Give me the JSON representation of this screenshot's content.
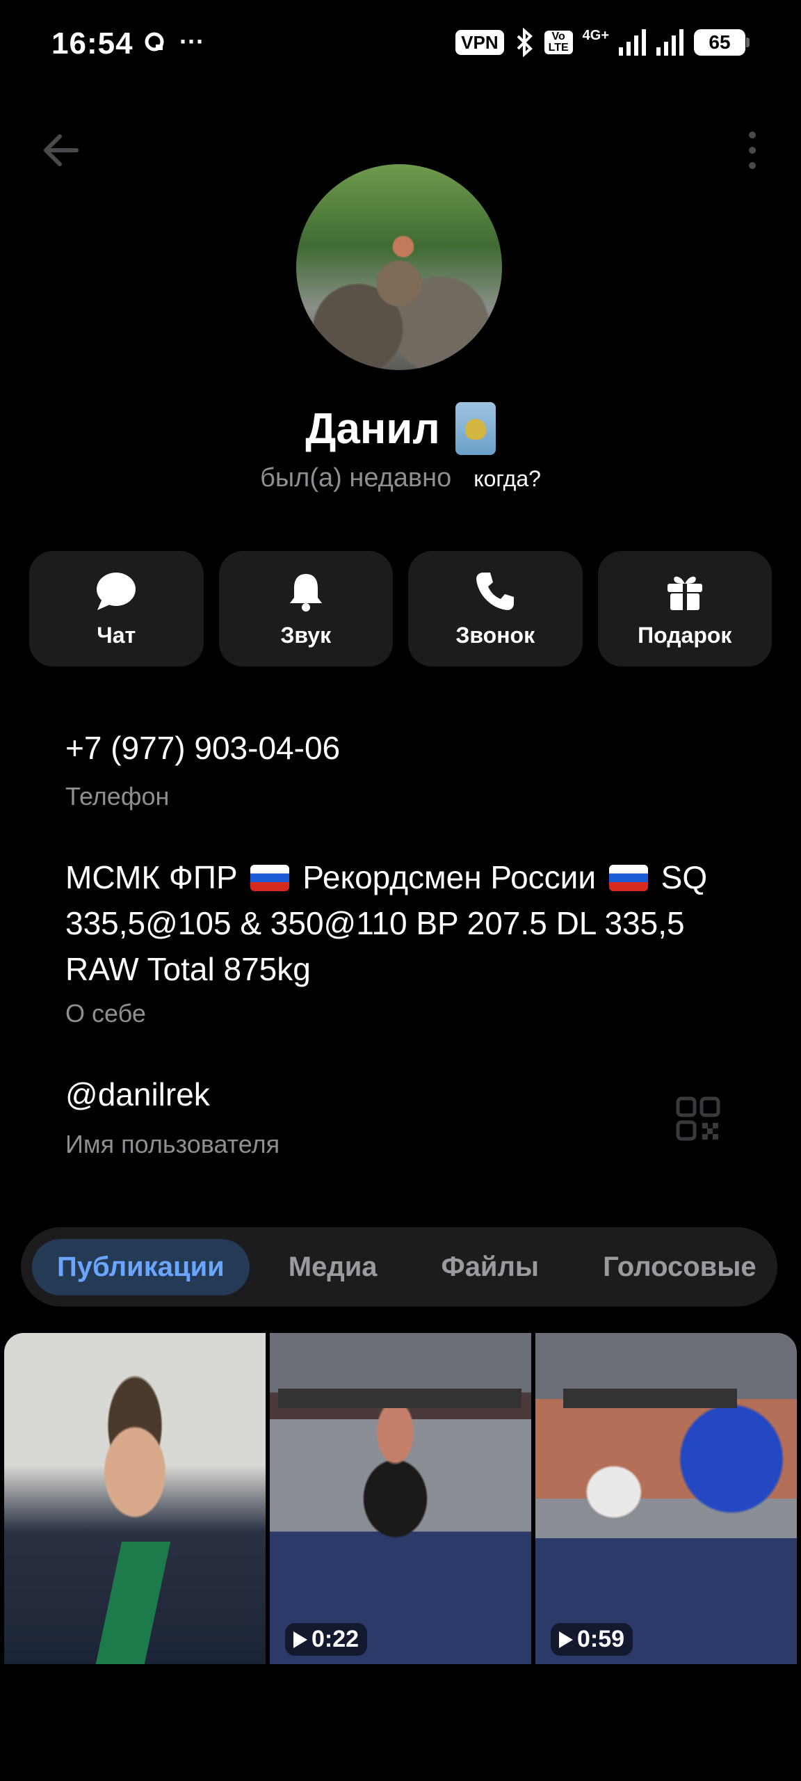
{
  "status_bar": {
    "time": "16:54",
    "vpn": "VPN",
    "volte": "Vo\nLTE",
    "network": "4G+",
    "battery": "65"
  },
  "profile": {
    "name": "Данил",
    "last_seen": "был(а) недавно",
    "when_link": "когда?"
  },
  "actions": [
    {
      "label": "Чат",
      "icon": "chat-bubble-icon"
    },
    {
      "label": "Звук",
      "icon": "bell-icon"
    },
    {
      "label": "Звонок",
      "icon": "phone-icon"
    },
    {
      "label": "Подарок",
      "icon": "gift-icon"
    }
  ],
  "info": {
    "phone": "+7 (977) 903-04-06",
    "phone_label": "Телефон",
    "bio_part1": "МСМК ФПР",
    "bio_part2": "Рекордсмен России",
    "bio_part3": "SQ 335,5@105 & 350@110 BP 207.5 DL 335,5 RAW Total 875kg",
    "bio_label": "О себе",
    "username": "@danilrek",
    "username_label": "Имя пользователя"
  },
  "tabs": [
    "Публикации",
    "Медиа",
    "Файлы",
    "Голосовые"
  ],
  "active_tab": "Публикации",
  "media": [
    {
      "type": "photo"
    },
    {
      "type": "video",
      "duration": "0:22"
    },
    {
      "type": "video",
      "duration": "0:59"
    }
  ],
  "colors": {
    "background": "#000000",
    "card": "#1c1c1e",
    "accent": "#6aa6ff",
    "secondary_text": "#8e8e93"
  }
}
